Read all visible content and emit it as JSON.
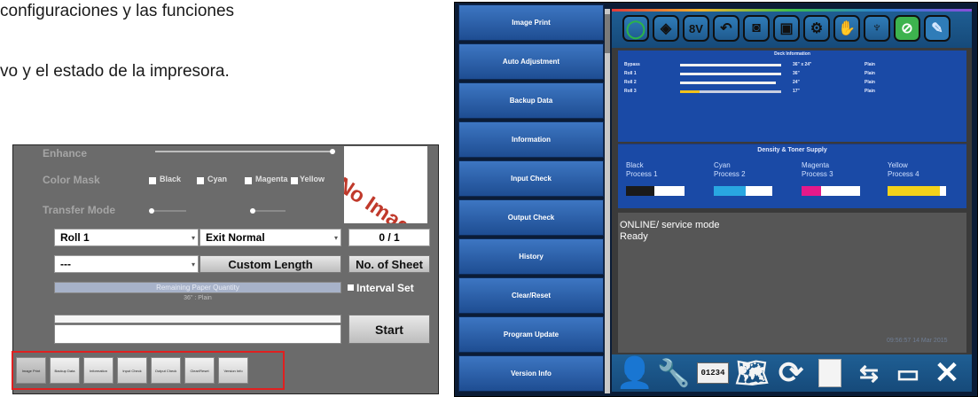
{
  "document": {
    "line1": "configuraciones y las funciones",
    "line2": "vo y el estado de la impresora."
  },
  "left_panel": {
    "enhance_label": "Enhance",
    "color_mask_label": "Color Mask",
    "color_mask_options": [
      "Black",
      "Cyan",
      "Magenta",
      "Yellow"
    ],
    "transfer_mode_label": "Transfer Mode",
    "no_image_text": "No Image",
    "roll_select": "Roll 1",
    "exit_select": "Exit Normal",
    "counter": "0 / 1",
    "blank_select": "---",
    "custom_length_button": "Custom Length",
    "no_of_sheet_button": "No. of Sheet",
    "remaining_paper_label": "Remaining Paper Quantity",
    "paper_size_text": "36\" : Plain",
    "interval_set_label": "Interval Set",
    "start_button": "Start",
    "tabs": [
      "Image Print",
      "Backup Data",
      "Information",
      "Input Check",
      "Output Check",
      "Clear/Reset",
      "Version Info"
    ]
  },
  "right_panel": {
    "side_menu": [
      "Image Print",
      "Auto Adjustment",
      "Backup Data",
      "Information",
      "Input Check",
      "Output Check",
      "History",
      "Clear/Reset",
      "Program Update",
      "Version Info"
    ],
    "top_icons": [
      "power-icon",
      "warning-icon",
      "eight-v-icon",
      "curve-icon",
      "camera-icon",
      "printer-icon",
      "gear-sheet-icon",
      "hand-icon",
      "cup-icon",
      "ok-icon",
      "wrench-icon"
    ],
    "deck_title": "Deck Information",
    "deck_rows": [
      {
        "name": "Bypass",
        "size": "36\" x 24\"",
        "media": "Plain",
        "level": 1.0
      },
      {
        "name": "Roll 1",
        "size": "36\"",
        "media": "Plain",
        "level": 1.0
      },
      {
        "name": "Roll 2",
        "size": "24\"",
        "media": "Plain",
        "level": 0.95
      },
      {
        "name": "Roll 3",
        "size": "17\"",
        "media": "Plain",
        "level": 0.18
      }
    ],
    "density_title": "Density & Toner Supply",
    "toners": [
      {
        "name": "Black",
        "process": "Process 1",
        "color": "#1a1a1a",
        "level": 0.48
      },
      {
        "name": "Cyan",
        "process": "Process 2",
        "color": "#29a7e1",
        "level": 0.55
      },
      {
        "name": "Magenta",
        "process": "Process 3",
        "color": "#e5198a",
        "level": 0.33
      },
      {
        "name": "Yellow",
        "process": "Process 4",
        "color": "#f2d21a",
        "level": 0.9
      }
    ],
    "status_line1": "ONLINE/ service mode",
    "status_line2": "Ready",
    "timestamp": "09:56:57 14 Mar 2015",
    "bottom_icons": [
      "user-icon",
      "wrench-icon",
      "counter-icon",
      "map-icon",
      "refresh-icon",
      "blank-page-icon",
      "usb-icon",
      "monitor-icon",
      "close-icon"
    ],
    "counter_icon_text": "01234"
  }
}
